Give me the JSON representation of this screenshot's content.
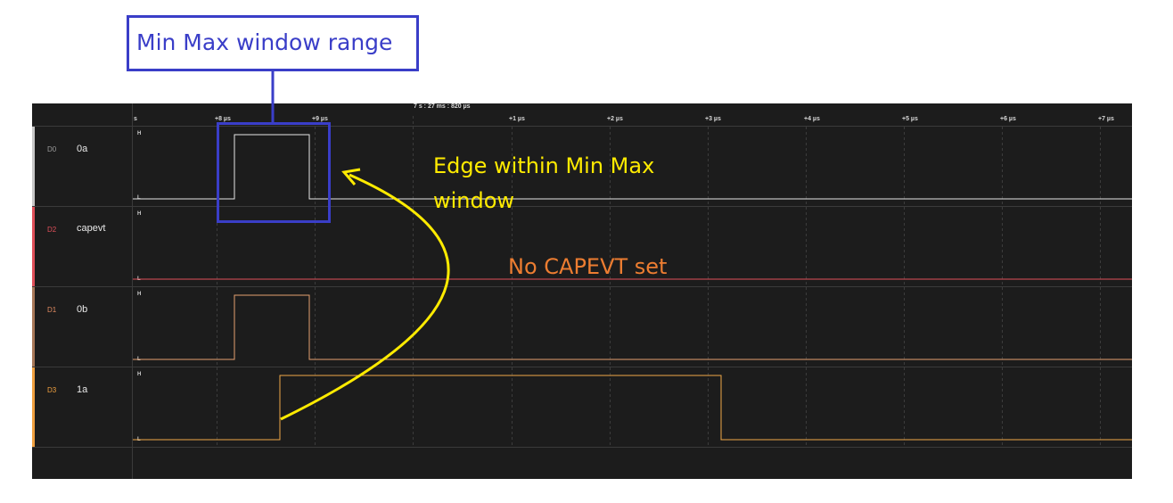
{
  "header": {
    "cursor_time": "7 s : 27 ms : 820 µs",
    "ticks": [
      {
        "label": "s"
      },
      {
        "label": "+8 µs"
      },
      {
        "label": "+9 µs"
      },
      {
        "label": "+1 µs"
      },
      {
        "label": "+2 µs"
      },
      {
        "label": "+3 µs"
      },
      {
        "label": "+4 µs"
      },
      {
        "label": "+5 µs"
      },
      {
        "label": "+6 µs"
      },
      {
        "label": "+7 µs"
      }
    ]
  },
  "channels": [
    {
      "id": "D0",
      "name": "0a",
      "color": "#c8c8c8",
      "id_color": "#9a9a9a",
      "wave_color": "#e6e6e6"
    },
    {
      "id": "D2",
      "name": "capevt",
      "color": "#e0505a",
      "id_color": "#e0505a",
      "wave_color": "#e0505a"
    },
    {
      "id": "D1",
      "name": "0b",
      "color": "#a87858",
      "id_color": "#e08a60",
      "wave_color": "#e3a070"
    },
    {
      "id": "D3",
      "name": "1a",
      "color": "#f0a040",
      "id_color": "#f0a040",
      "wave_color": "#f0a848"
    }
  ],
  "level_labels": {
    "high": "H",
    "low": "L"
  },
  "annotations": {
    "min_max_label": "Min Max window range",
    "edge_label_line1": "Edge within Min Max",
    "edge_label_line2": "window",
    "no_capevt_label": "No CAPEVT set",
    "blue_color": "#3a3ec8",
    "yellow_color": "#ffeb00",
    "orange_color": "#ed7d31"
  }
}
